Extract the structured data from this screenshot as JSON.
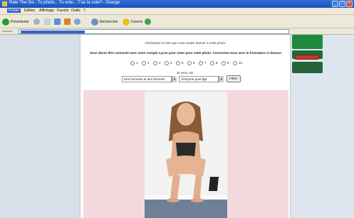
{
  "window": {
    "title": "Rate The Sis - Tu photo... Tu vote... T'as la cote? - Orange",
    "controls": [
      "_",
      "□",
      "×"
    ]
  },
  "menu": {
    "items": [
      "Fichier",
      "Edition",
      "Affichage",
      "Favoris",
      "Outils",
      "?"
    ]
  },
  "toolbar": {
    "back_label": "Précédente",
    "search_label": "Rechercher",
    "favorites_label": "Favoris"
  },
  "addressbar": {
    "label": "Adresse"
  },
  "page": {
    "instruction": "Choisissez la note que vous voulez donner à cette photo :",
    "login_notice": "Vous devez être connecté avec votre compte Lycos pour voter pour cette photo. Connectez-vous avec le formulaire ci-dessus.",
    "ratings": [
      "1",
      "2",
      "3",
      "4",
      "5",
      "6",
      "7",
      "8",
      "9",
      "10"
    ],
    "want_label": "Je veux voir :",
    "filter_gender": "Des hommes et des femmes",
    "filter_age": "n'importe quel âge",
    "filter_button": "Filtrer"
  },
  "colors": {
    "titlebar": "#1d4fb8",
    "page_bg": "#dfe6ef",
    "photo_bg": "#f3d9dd",
    "ad_green": "#1f8a3e",
    "ad_button": "#c0392b"
  }
}
